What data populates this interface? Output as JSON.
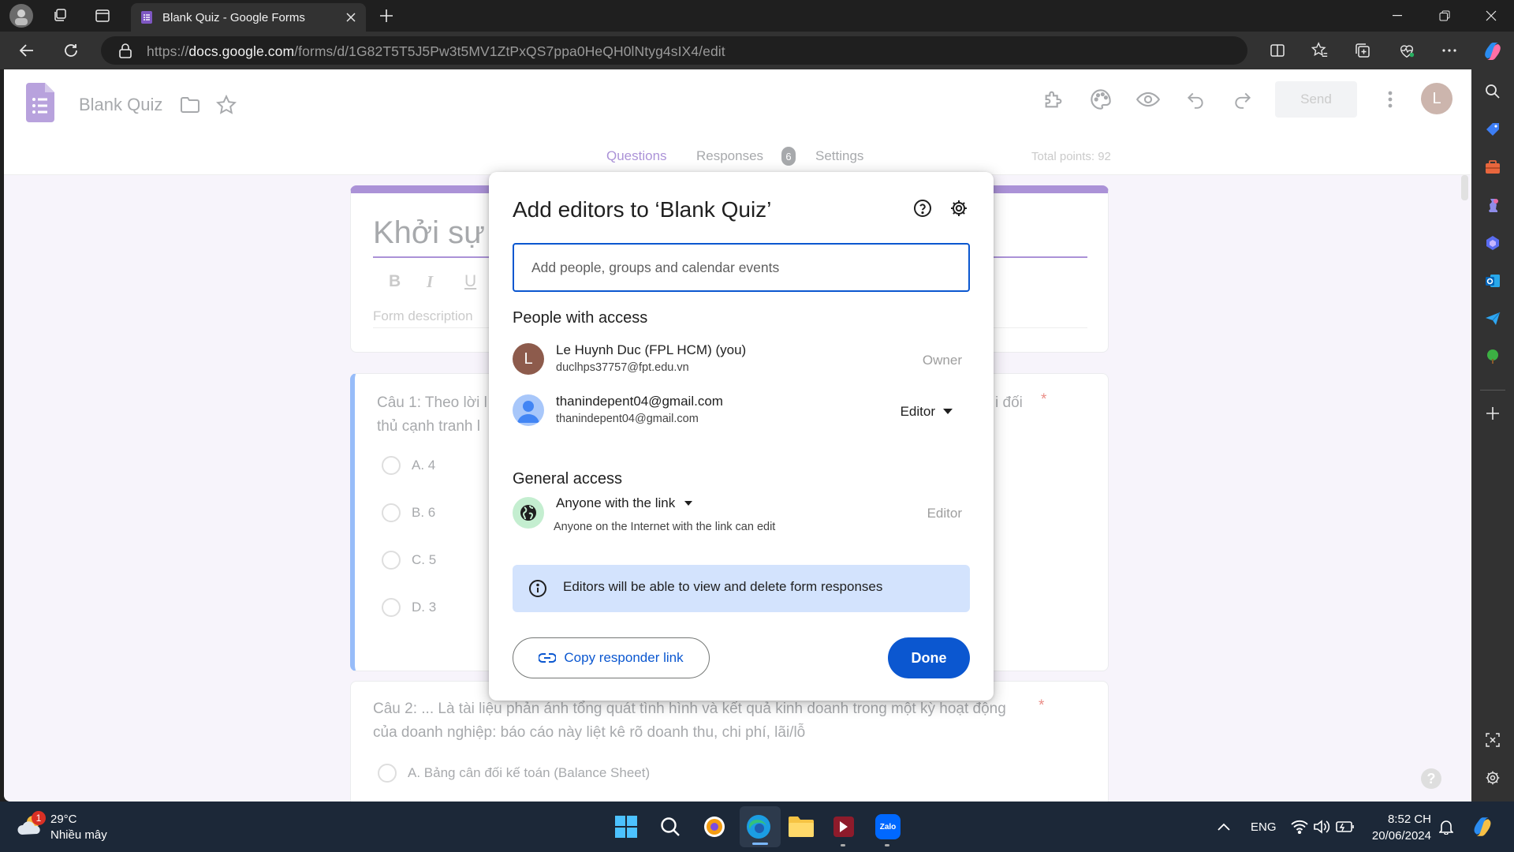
{
  "browser": {
    "tab_title": "Blank Quiz - Google Forms",
    "url_prefix": "https://",
    "url_domain": "docs.google.com",
    "url_path": "/forms/d/1G82T5T5J5Pw3t5MV1ZtPxQS7ppa0HeQH0lNtyg4sIX4/edit"
  },
  "forms_header": {
    "title": "Blank Quiz",
    "send_label": "Send",
    "avatar_letter": "L",
    "tabs": {
      "questions": "Questions",
      "responses": "Responses",
      "responses_count": "6",
      "settings": "Settings"
    },
    "total_points": "Total points: 92"
  },
  "form": {
    "title_partial": "Khởi sự",
    "description_placeholder": "Form description",
    "format_buttons": [
      "B",
      "I",
      "U"
    ],
    "q1": {
      "text_left_line1": "Câu 1: Theo lời l",
      "text_right_line1": "i đối",
      "text_left_line2": "thủ cạnh tranh l",
      "required": "*",
      "options": [
        "A. 4",
        "B. 6",
        "C. 5",
        "D. 3"
      ]
    },
    "q2": {
      "text_line1": "Câu 2: ... Là tài liệu phản ánh tổng quát tình hình và kết quả kinh doanh trong một kỳ hoạt động",
      "text_line2": "của doanh nghiệp: báo cáo này liệt kê rõ doanh thu, chi phí, lãi/lỗ",
      "required": "*",
      "option_a": "A. Bảng cân đối kế toán (Balance Sheet)"
    }
  },
  "dialog": {
    "title": "Add editors to ‘Blank Quiz’",
    "input_placeholder": "Add people, groups and calendar events",
    "people_heading": "People with access",
    "people": [
      {
        "avatar": "L",
        "name": "Le Huynh Duc (FPL HCM) (you)",
        "email": "duclhps37757@fpt.edu.vn",
        "role": "Owner"
      },
      {
        "name": "thanindepent04@gmail.com",
        "email": "thanindepent04@gmail.com",
        "role": "Editor"
      }
    ],
    "general_heading": "General access",
    "general": {
      "scope": "Anyone with the link",
      "desc": "Anyone on the Internet with the link can edit",
      "role": "Editor"
    },
    "info_text": "Editors will be able to view and delete form responses",
    "copy_link_label": "Copy responder link",
    "done_label": "Done"
  },
  "taskbar": {
    "weather_temp": "29°C",
    "weather_desc": "Nhiều mây",
    "weather_badge": "1",
    "lang": "ENG",
    "time": "8:52 CH",
    "date": "20/06/2024",
    "zalo_label": "Zalo"
  },
  "colors": {
    "forms_purple": "#673ab7",
    "dialog_blue": "#0b57d0",
    "info_bg": "#d3e3fd",
    "page_bg": "#f0ebf8",
    "taskbar_bg": "#1c2838"
  }
}
